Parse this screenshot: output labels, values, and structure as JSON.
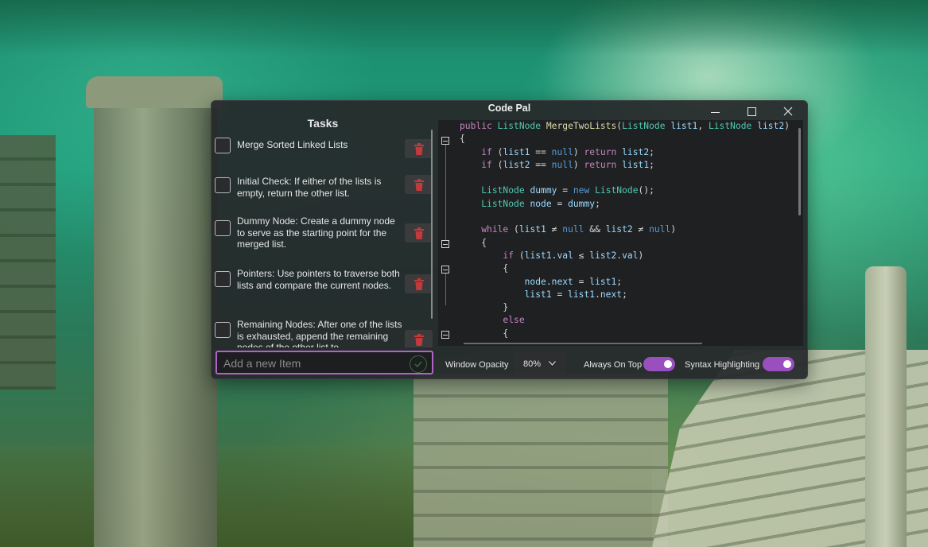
{
  "app": {
    "title": "Code Pal"
  },
  "tasks": {
    "heading": "Tasks",
    "items": [
      {
        "text": "Merge Sorted Linked Lists",
        "checked": false
      },
      {
        "text": "Initial Check: If either of the lists is empty, return the other list.",
        "checked": false
      },
      {
        "text": "Dummy Node: Create a dummy node to serve as the starting point for the merged list.",
        "checked": false
      },
      {
        "text": "Pointers: Use pointers to traverse both lists and compare the current nodes.",
        "checked": false
      },
      {
        "text": "Remaining Nodes: After one of the lists is exhausted, append the remaining nodes of the other list to",
        "checked": false
      }
    ],
    "add_placeholder": "Add a new Item"
  },
  "editor": {
    "language": "C#",
    "visible_lines": [
      "public ListNode MergeTwoLists(ListNode list1, ListNode list2)",
      "{",
      "if (list1 == null) return list2;",
      "if (list2 == null) return list1;",
      "ListNode dummy = new ListNode();",
      "ListNode node = dummy;",
      "while (list1 ≠ null && list2 ≠ null)",
      "{",
      "if (list1.val ≤ list2.val)",
      "{",
      "node.next = list1;",
      "list1 = list1.next;",
      "}",
      "else",
      "{"
    ]
  },
  "settings": {
    "opacity_label": "Window Opacity",
    "opacity_value": "80%",
    "always_on_top_label": "Always On Top",
    "always_on_top": true,
    "syntax_highlighting_label": "Syntax Highlighting",
    "syntax_highlighting": true
  },
  "colors": {
    "accent": "#b063c8",
    "toggle_on": "#9a4fbf",
    "delete_icon": "#c43a3a",
    "window_bg": "#26282a"
  },
  "icons": {
    "minimize": "minimize-icon",
    "maximize": "maximize-icon",
    "close": "close-icon",
    "delete": "trash-icon",
    "confirm": "check-icon",
    "dropdown": "chevron-down-icon"
  }
}
